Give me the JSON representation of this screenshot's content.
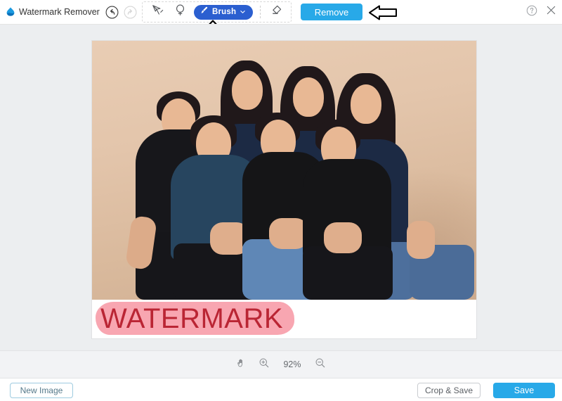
{
  "app": {
    "title": "Watermark Remover",
    "logo_icon": "water-drop-logo-icon"
  },
  "topbar": {
    "undo_icon": "undo-circle-icon",
    "redo_icon": "redo-circle-icon",
    "tools": [
      {
        "id": "polygon",
        "icon": "polygon-select-icon",
        "label": "Polygon",
        "active": false
      },
      {
        "id": "lasso",
        "icon": "lasso-select-icon",
        "label": "Lasso",
        "active": false
      },
      {
        "id": "brush",
        "icon": "brush-icon",
        "label": "Brush",
        "active": true,
        "dropdown_icon": "chevron-down-icon"
      },
      {
        "id": "eraser",
        "icon": "eraser-icon",
        "label": "Eraser",
        "active": false
      }
    ],
    "remove_label": "Remove",
    "help_icon": "help-circle-icon",
    "close_icon": "close-icon",
    "annotations": [
      {
        "id": "arrow-remove",
        "icon": "arrow-left-annotation",
        "points_to": "Remove"
      },
      {
        "id": "arrow-brush",
        "icon": "arrow-up-annotation",
        "points_to": "Brush"
      }
    ]
  },
  "canvas": {
    "watermark_text": "WATERMARK",
    "watermark_color": "#8d1118",
    "mask_color": "#f03c55",
    "photo_alt": "Group photo of seven people posing in a studio against a beige backdrop"
  },
  "zoombar": {
    "pan_icon": "hand-pan-icon",
    "zoom_in_icon": "zoom-in-icon",
    "zoom_level": "92%",
    "zoom_out_icon": "zoom-out-icon"
  },
  "footer": {
    "new_image_label": "New Image",
    "crop_save_label": "Crop & Save",
    "save_label": "Save"
  },
  "colors": {
    "brush_active": "#2b5fd0",
    "primary_blue": "#28a9e8",
    "workspace_bg": "#eceef0",
    "zoombar_bg": "#f2f3f5"
  }
}
